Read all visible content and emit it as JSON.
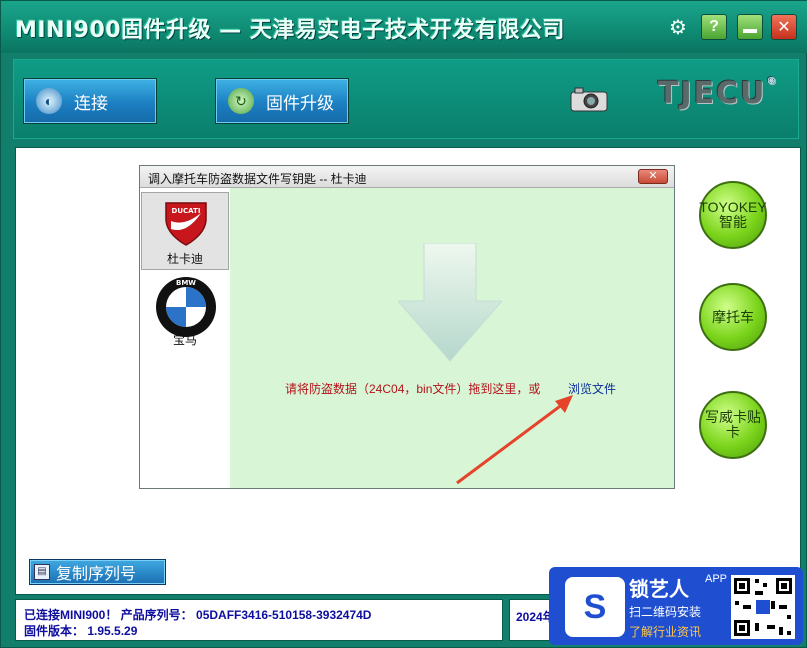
{
  "window": {
    "title": "MINI900固件升级 — 天津易实电子技术开发有限公司"
  },
  "titlebar": {
    "help_label": "?",
    "close_label": "✕"
  },
  "toolbar": {
    "connect_label": "连接",
    "firmware_label": "固件升级",
    "logo_text": "TJECU",
    "logo_mark": "®"
  },
  "side_buttons": {
    "toyokey": "TOYOKEY智能",
    "motorcycle": "摩托车",
    "write_card": "写威卡贴卡"
  },
  "dialog": {
    "title": "调入摩托车防盗数据文件写钥匙 -- 杜卡迪",
    "close_label": "✕",
    "brands": [
      {
        "label": "杜卡迪",
        "logo_text": "DUCATI"
      },
      {
        "label": "宝马",
        "logo_text": "BMW"
      }
    ],
    "drop_message": "请将防盗数据（24C04，bin文件）拖到这里，或",
    "browse_label": "浏览文件"
  },
  "copy_serial_label": "复制序列号",
  "status": {
    "line1": "已连接MINI900！  产品序列号：  05DAFF3416-510158-3932474D",
    "line2": "固件版本：  1.95.5.29",
    "right_text": "2024年"
  },
  "ad": {
    "name": "锁艺人",
    "app": "APP",
    "line2": "扫二维码安装",
    "line3": "了解行业资讯"
  },
  "colors": {
    "frame": "#117f6c",
    "toolbar_button": "#1c7fc2",
    "side_button": "#7bd41b",
    "dialog_bg": "#d6f5d6",
    "drop_message": "#b4121b",
    "status_text": "#0d0d9e",
    "ad_bg": "#1f4fd0"
  }
}
